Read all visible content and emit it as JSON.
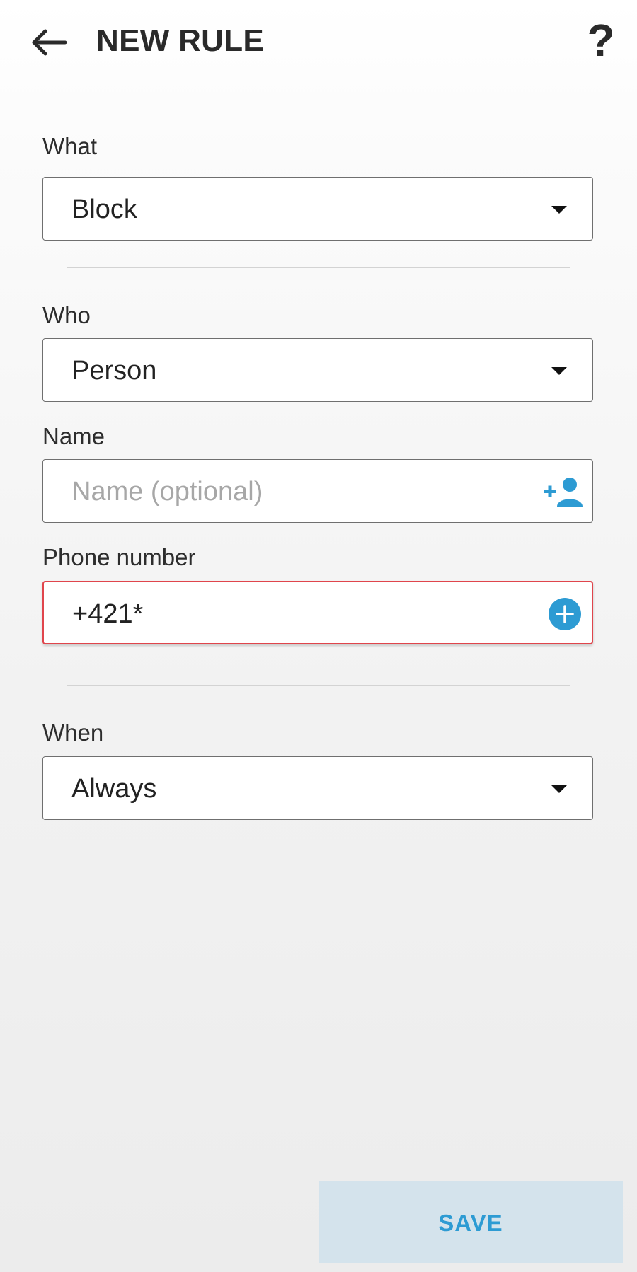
{
  "header": {
    "title": "NEW RULE",
    "help_label": "?"
  },
  "what": {
    "label": "What",
    "value": "Block"
  },
  "who": {
    "label": "Who",
    "value": "Person"
  },
  "name": {
    "label": "Name",
    "placeholder": "Name (optional)",
    "value": ""
  },
  "phone": {
    "label": "Phone number",
    "value": "+421*"
  },
  "when": {
    "label": "When",
    "value": "Always"
  },
  "actions": {
    "save_label": "SAVE"
  },
  "colors": {
    "accent": "#2D9BD3",
    "save_background": "#D4E3EC",
    "highlight_border": "#E0454C"
  },
  "icons": {
    "back": "arrow-left-icon",
    "help": "question-mark-icon",
    "dropdown": "caret-down-icon",
    "add_contact": "person-add-icon",
    "add_number": "plus-circle-icon"
  }
}
